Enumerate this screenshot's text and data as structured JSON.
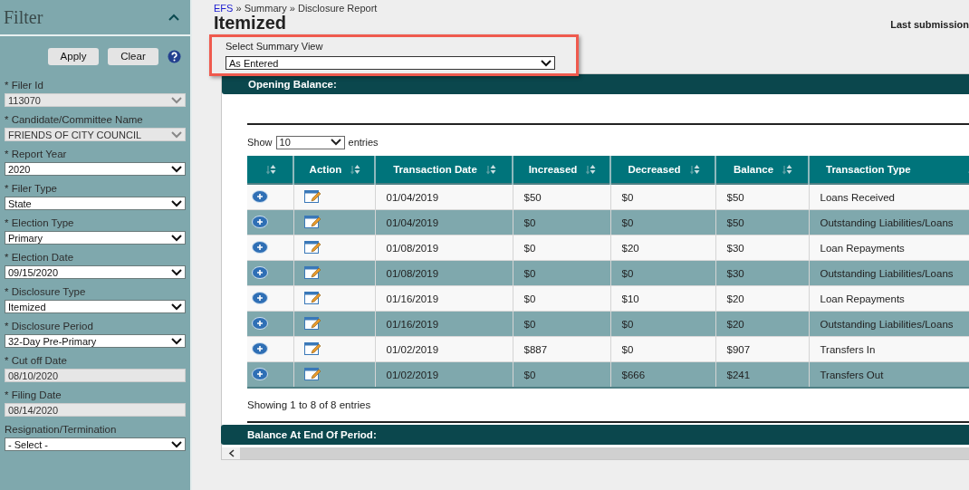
{
  "sidebar": {
    "title": "Filter",
    "buttons": [
      "Apply",
      "Clear"
    ],
    "fields": [
      {
        "label": "* Filer Id",
        "kind": "select",
        "value": "113070",
        "disabled": true
      },
      {
        "label": "* Candidate/Committee Name",
        "kind": "select",
        "value": "FRIENDS OF CITY COUNCIL",
        "disabled": true
      },
      {
        "label": "* Report Year",
        "kind": "select",
        "value": "2020",
        "disabled": false
      },
      {
        "label": "* Filer Type",
        "kind": "select",
        "value": "State",
        "disabled": false
      },
      {
        "label": "* Election Type",
        "kind": "select",
        "value": "Primary",
        "disabled": false
      },
      {
        "label": "* Election Date",
        "kind": "select",
        "value": "09/15/2020",
        "disabled": false
      },
      {
        "label": "* Disclosure Type",
        "kind": "select",
        "value": "Itemized",
        "disabled": false
      },
      {
        "label": "* Disclosure Period",
        "kind": "select",
        "value": "32-Day Pre-Primary",
        "disabled": false
      },
      {
        "label": "* Cut off Date",
        "kind": "input",
        "value": "08/10/2020",
        "disabled": true
      },
      {
        "label": "* Filing Date",
        "kind": "input",
        "value": "08/14/2020",
        "disabled": true
      },
      {
        "label": "Resignation/Termination",
        "kind": "select",
        "value": "- Select -",
        "disabled": false
      }
    ]
  },
  "breadcrumb": [
    "EFS",
    "Summary",
    "Disclosure Report"
  ],
  "breadcrumb_separator": "»",
  "page_title": "Itemized",
  "last_submission": "Last submission",
  "summary_view": {
    "label": "Select Summary View",
    "value": "As Entered"
  },
  "opening_balance": "Opening Balance:",
  "length_menu": {
    "before": "Show",
    "value": "10",
    "after": "entries"
  },
  "table": {
    "columns": [
      "",
      "Action",
      "Transaction Date",
      "Increased",
      "Decreased",
      "Balance",
      "Transaction Type"
    ],
    "rows": [
      {
        "date": "01/04/2019",
        "increased": "$50",
        "decreased": "$0",
        "balance": "$50",
        "type": "Loans Received"
      },
      {
        "date": "01/04/2019",
        "increased": "$0",
        "decreased": "$0",
        "balance": "$50",
        "type": "Outstanding Liabilities/Loans"
      },
      {
        "date": "01/08/2019",
        "increased": "$0",
        "decreased": "$20",
        "balance": "$30",
        "type": "Loan Repayments"
      },
      {
        "date": "01/08/2019",
        "increased": "$0",
        "decreased": "$0",
        "balance": "$30",
        "type": "Outstanding Liabilities/Loans"
      },
      {
        "date": "01/16/2019",
        "increased": "$0",
        "decreased": "$10",
        "balance": "$20",
        "type": "Loan Repayments"
      },
      {
        "date": "01/16/2019",
        "increased": "$0",
        "decreased": "$0",
        "balance": "$20",
        "type": "Outstanding Liabilities/Loans"
      },
      {
        "date": "01/02/2019",
        "increased": "$887",
        "decreased": "$0",
        "balance": "$907",
        "type": "Transfers In"
      },
      {
        "date": "01/02/2019",
        "increased": "$0",
        "decreased": "$666",
        "balance": "$241",
        "type": "Transfers Out"
      }
    ]
  },
  "info": "Showing 1 to 8 of 8 entries",
  "end_balance": "Balance At End Of Period:"
}
